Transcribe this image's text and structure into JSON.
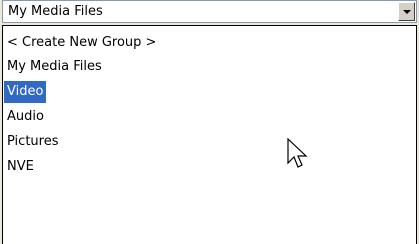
{
  "combo": {
    "value": "My Media Files",
    "arrow_icon": "chevron-down-icon"
  },
  "dropdown": {
    "options": [
      {
        "label": "< Create New Group >",
        "selected": false
      },
      {
        "label": "My Media Files",
        "selected": false
      },
      {
        "label": "Video",
        "selected": true
      },
      {
        "label": "Audio",
        "selected": false
      },
      {
        "label": "Pictures",
        "selected": false
      },
      {
        "label": "NVE",
        "selected": false
      }
    ]
  },
  "colors": {
    "selection_bg": "#316ac5",
    "selection_fg": "#ffffff",
    "combo_border": "#7f9db9"
  },
  "cursor_icon": "mouse-pointer-icon"
}
